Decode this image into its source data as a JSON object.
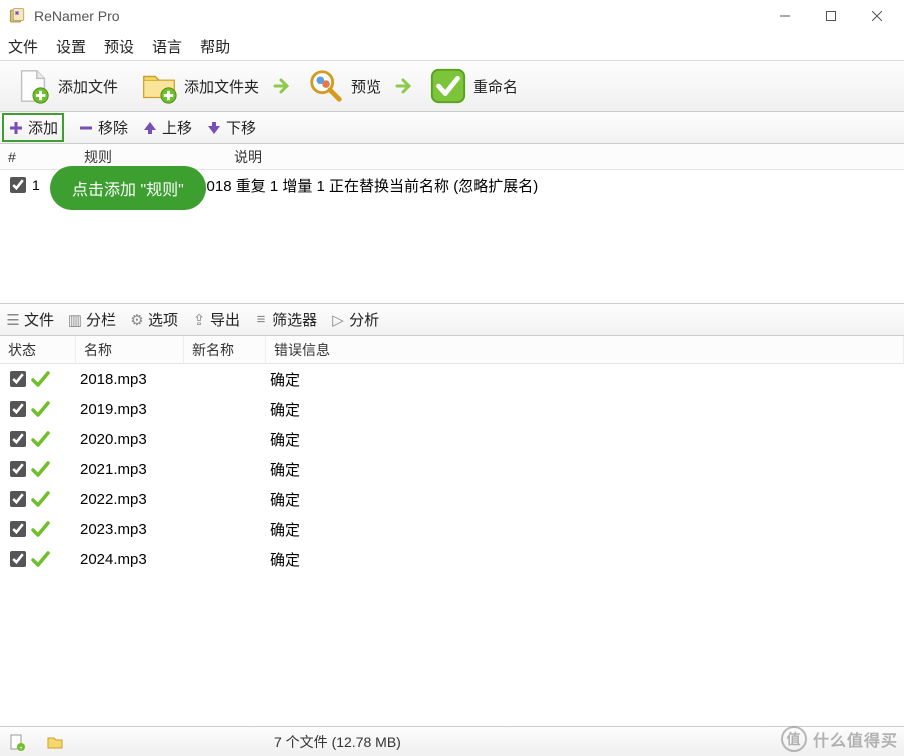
{
  "title": "ReNamer Pro",
  "menu": {
    "file": "文件",
    "settings": "设置",
    "presets": "预设",
    "language": "语言",
    "help": "帮助"
  },
  "toolbar": {
    "add_files": "添加文件",
    "add_folders": "添加文件夹",
    "preview": "预览",
    "rename": "重命名"
  },
  "rules_toolbar": {
    "add": "添加",
    "remove": "移除",
    "up": "上移",
    "down": "下移"
  },
  "rules_header": {
    "num": "#",
    "rule": "规则",
    "desc": "说明"
  },
  "rule_row": {
    "num": "1",
    "desc": "增量序列化起始于 2018 重复 1 增量 1 正在替换当前名称 (忽略扩展名)"
  },
  "tooltip": "点击添加 \"规则\"",
  "files_toolbar": {
    "files": "文件",
    "columns": "分栏",
    "options": "选项",
    "export": "导出",
    "filter": "筛选器",
    "analyze": "分析"
  },
  "files_header": {
    "state": "状态",
    "name": "名称",
    "newname": "新名称",
    "error": "错误信息"
  },
  "files": [
    {
      "name": "2018.mp3",
      "new": "",
      "err": "确定"
    },
    {
      "name": "2019.mp3",
      "new": "",
      "err": "确定"
    },
    {
      "name": "2020.mp3",
      "new": "",
      "err": "确定"
    },
    {
      "name": "2021.mp3",
      "new": "",
      "err": "确定"
    },
    {
      "name": "2022.mp3",
      "new": "",
      "err": "确定"
    },
    {
      "name": "2023.mp3",
      "new": "",
      "err": "确定"
    },
    {
      "name": "2024.mp3",
      "new": "",
      "err": "确定"
    }
  ],
  "status": {
    "file_count": "7 个文件 (12.78 MB)"
  },
  "watermark": {
    "badge": "值",
    "text": "什么值得买"
  },
  "colors": {
    "accent": "#6fbf2a",
    "green_dark": "#3c9f2f",
    "purple": "#7a4fb5"
  }
}
